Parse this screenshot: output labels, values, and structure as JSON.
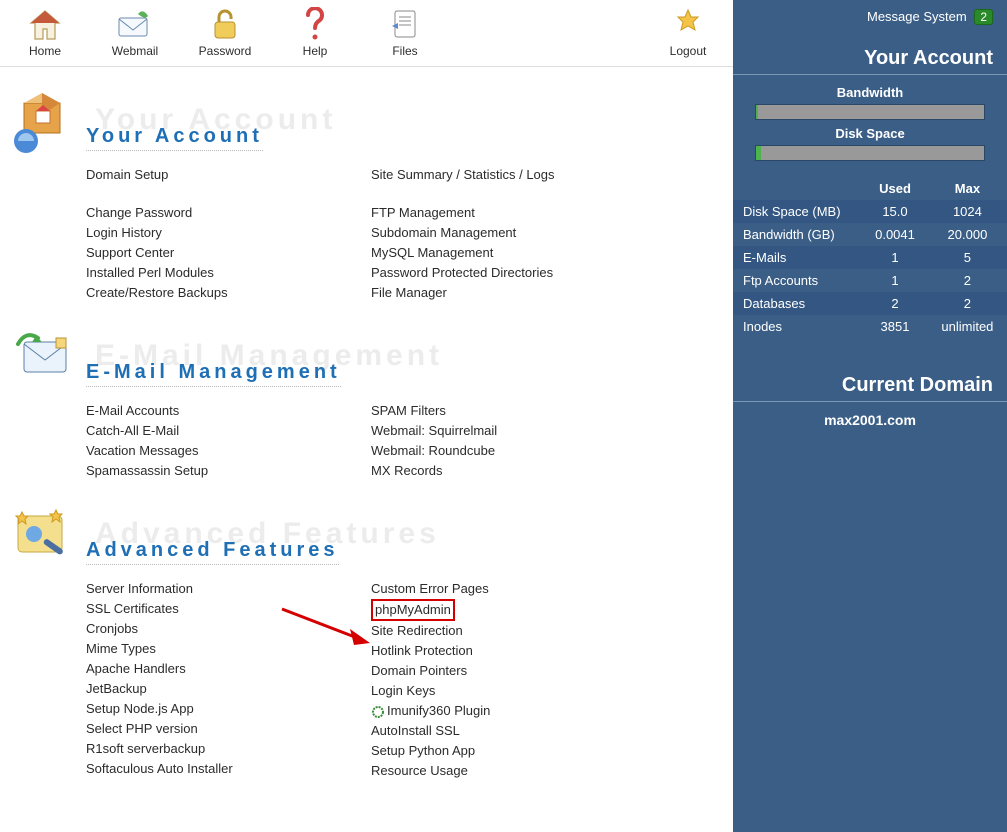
{
  "toolbar": {
    "home": "Home",
    "webmail": "Webmail",
    "password": "Password",
    "help": "Help",
    "files": "Files",
    "logout": "Logout"
  },
  "sections": {
    "account": {
      "title": "Your Account",
      "ghost": "Your Account",
      "left": [
        "Domain Setup",
        "",
        "Change Password",
        "Login History",
        "Support Center",
        "Installed Perl Modules",
        "Create/Restore Backups"
      ],
      "right": [
        "Site Summary / Statistics / Logs",
        "",
        "FTP Management",
        "Subdomain Management",
        "MySQL Management",
        "Password Protected Directories",
        "File Manager"
      ]
    },
    "email": {
      "title": "E-Mail Management",
      "ghost": "E-Mail Management",
      "left": [
        "E-Mail Accounts",
        "Catch-All E-Mail",
        "Vacation Messages",
        "Spamassassin Setup"
      ],
      "right": [
        "SPAM Filters",
        "Webmail: Squirrelmail",
        "Webmail: Roundcube",
        "MX Records"
      ]
    },
    "advanced": {
      "title": "Advanced Features",
      "ghost": "Advanced Features",
      "left": [
        "Server Information",
        "SSL Certificates",
        "Cronjobs",
        "Mime Types",
        "Apache Handlers",
        "JetBackup",
        "Setup Node.js App",
        "Select PHP version",
        "R1soft serverbackup",
        "Softaculous Auto Installer"
      ],
      "right": [
        "Custom Error Pages",
        "phpMyAdmin",
        "Site Redirection",
        "Hotlink Protection",
        "Domain Pointers",
        "Login Keys",
        "Imunify360 Plugin",
        "AutoInstall SSL",
        "Setup Python App",
        "Resource Usage"
      ],
      "highlight_index": 1
    }
  },
  "sidebar": {
    "message_system": "Message System",
    "message_count": "2",
    "your_account": "Your Account",
    "bandwidth_label": "Bandwidth",
    "diskspace_label": "Disk Space",
    "cols": {
      "used": "Used",
      "max": "Max"
    },
    "rows": [
      {
        "label": "Disk Space (MB)",
        "used": "15.0",
        "max": "1024"
      },
      {
        "label": "Bandwidth (GB)",
        "used": "0.0041",
        "max": "20.000"
      },
      {
        "label": "E-Mails",
        "used": "1",
        "max": "5"
      },
      {
        "label": "Ftp Accounts",
        "used": "1",
        "max": "2"
      },
      {
        "label": "Databases",
        "used": "2",
        "max": "2"
      },
      {
        "label": "Inodes",
        "used": "3851",
        "max": "unlimited"
      }
    ],
    "current_domain_heading": "Current Domain",
    "current_domain": "max2001.com"
  }
}
